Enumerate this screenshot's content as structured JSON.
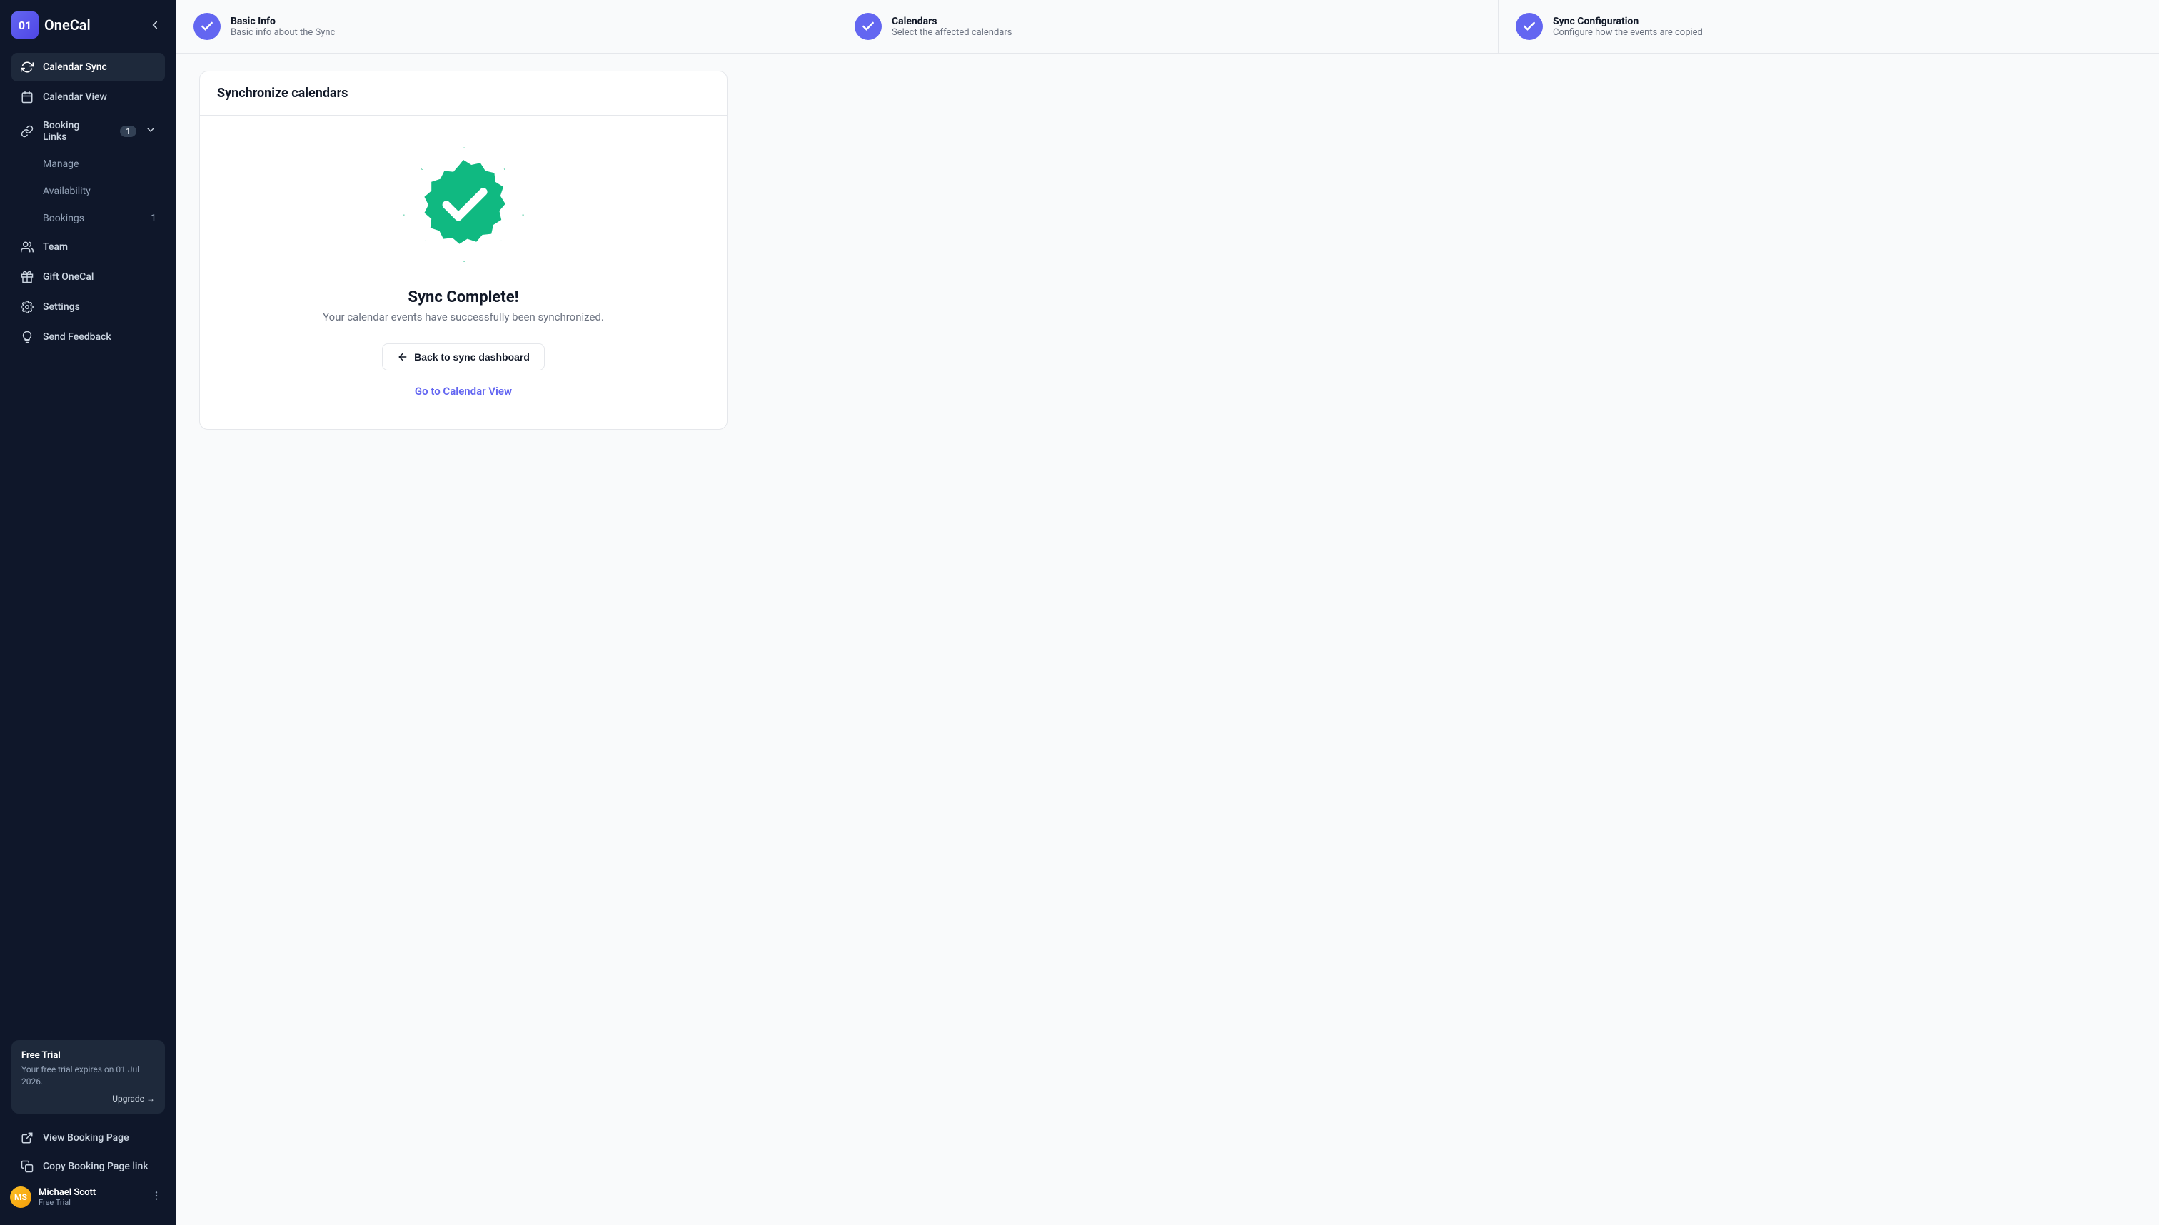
{
  "brand": {
    "mark": "01",
    "name": "OneCal"
  },
  "sidebar": {
    "items": [
      {
        "label": "Calendar Sync"
      },
      {
        "label": "Calendar View"
      },
      {
        "label": "Booking Links",
        "badge": "1"
      },
      {
        "label": "Team"
      },
      {
        "label": "Gift OneCal"
      },
      {
        "label": "Settings"
      },
      {
        "label": "Send Feedback"
      }
    ],
    "booking_sub": [
      {
        "label": "Manage"
      },
      {
        "label": "Availability"
      },
      {
        "label": "Bookings",
        "badge": "1"
      }
    ],
    "footer_links": [
      {
        "label": "View Booking Page"
      },
      {
        "label": "Copy Booking Page link"
      }
    ]
  },
  "trial": {
    "title": "Free Trial",
    "text": "Your free trial expires on 01 Jul 2026.",
    "upgrade": "Upgrade →"
  },
  "user": {
    "name": "Michael Scott",
    "plan": "Free Trial"
  },
  "steps": [
    {
      "title": "Basic Info",
      "desc": "Basic info about the Sync"
    },
    {
      "title": "Calendars",
      "desc": "Select the affected calendars"
    },
    {
      "title": "Sync Configuration",
      "desc": "Configure how the events are copied"
    }
  ],
  "card": {
    "header": "Synchronize calendars",
    "success_title": "Sync Complete!",
    "success_text": "Your calendar events have successfully been synchronized.",
    "back_btn": "Back to sync dashboard",
    "link": "Go to Calendar View"
  }
}
